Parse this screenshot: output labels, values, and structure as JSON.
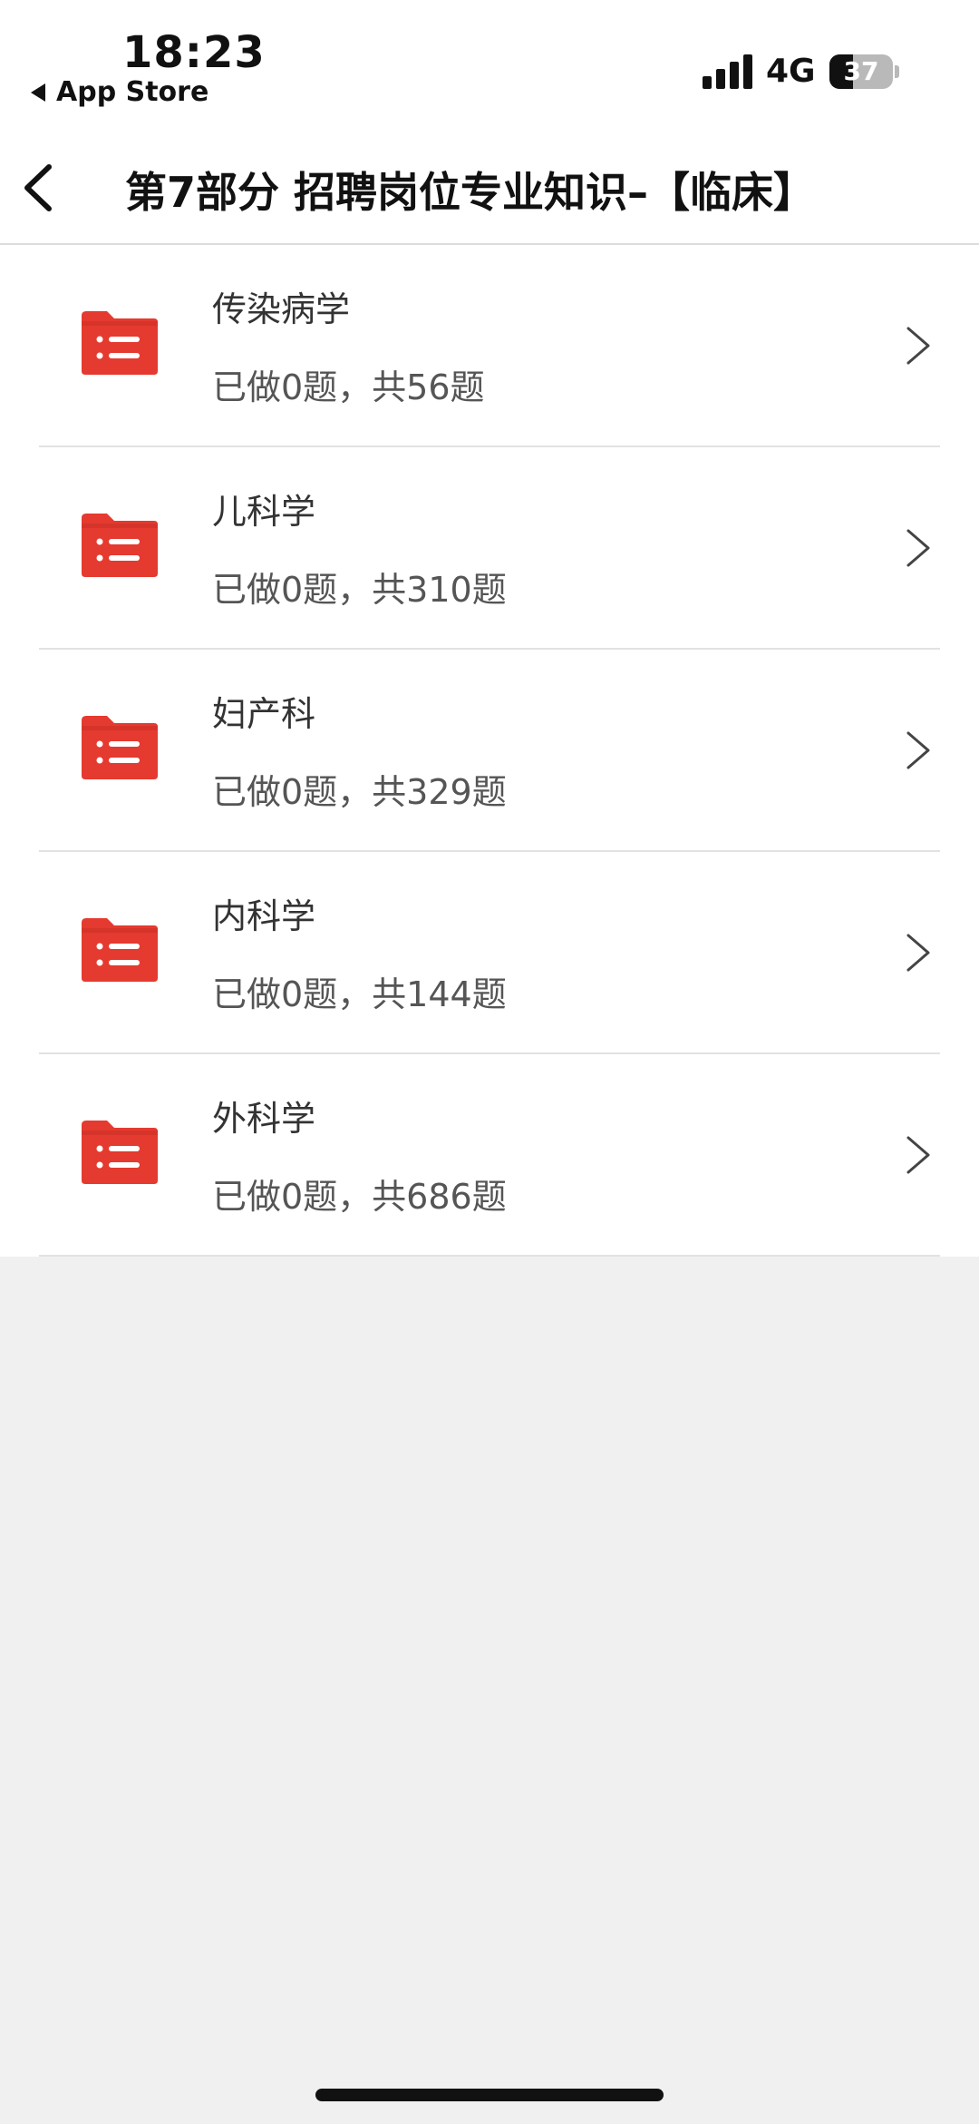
{
  "status_bar": {
    "time": "18:23",
    "back_app": "App Store",
    "network": "4G",
    "battery": "37",
    "battery_level": 0.37
  },
  "nav": {
    "title": "第7部分 招聘岗位专业知识–【临床】"
  },
  "colors": {
    "icon_red": "#e53a2f",
    "separator": "#e2e2e2",
    "page_bg": "#f0f0f0"
  },
  "items": [
    {
      "title": "传染病学",
      "progress": "已做0题，共56题",
      "icon": "list-folder-icon"
    },
    {
      "title": "儿科学",
      "progress": "已做0题，共310题",
      "icon": "list-folder-icon"
    },
    {
      "title": "妇产科",
      "progress": "已做0题，共329题",
      "icon": "list-folder-icon"
    },
    {
      "title": "内科学",
      "progress": "已做0题，共144题",
      "icon": "list-folder-icon"
    },
    {
      "title": "外科学",
      "progress": "已做0题，共686题",
      "icon": "list-folder-icon"
    }
  ]
}
